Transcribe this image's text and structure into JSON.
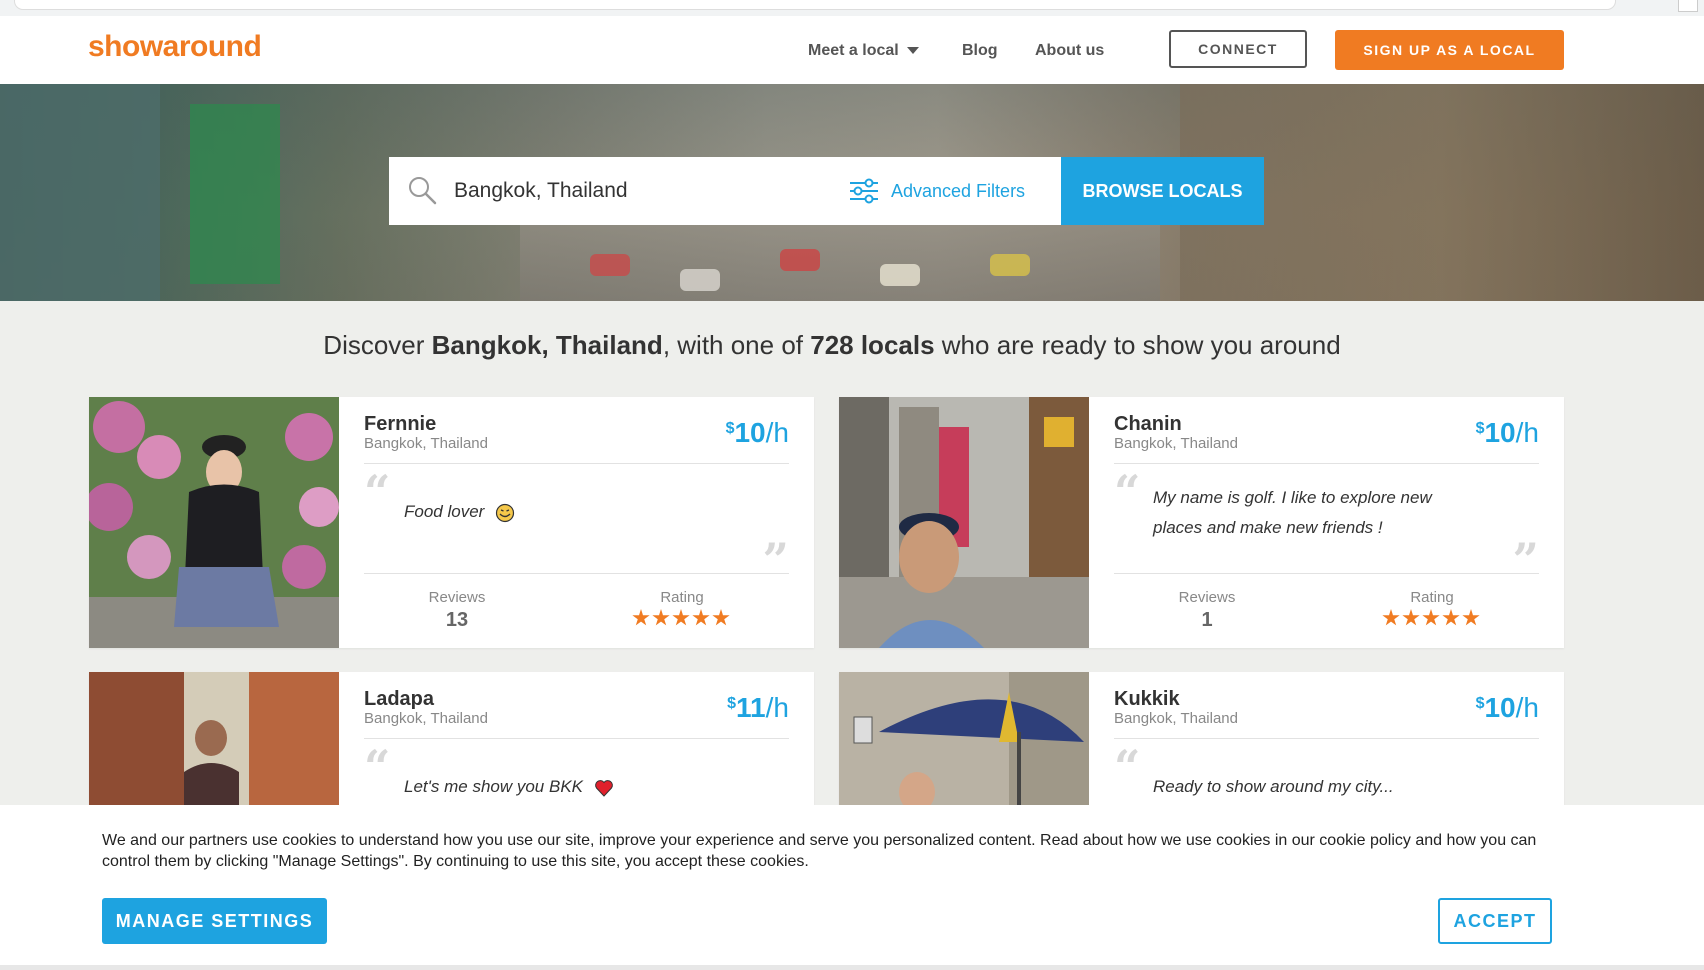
{
  "header": {
    "logo": "showaround",
    "nav": {
      "meet_local": "Meet a local",
      "blog": "Blog",
      "about": "About us"
    },
    "connect_label": "CONNECT",
    "signup_label": "SIGN UP AS A LOCAL"
  },
  "search": {
    "value": "Bangkok, Thailand",
    "filters_label": "Advanced Filters",
    "browse_label": "BROWSE LOCALS"
  },
  "discover": {
    "prefix": "Discover ",
    "city": "Bangkok, Thailand",
    "middle": ", with one of ",
    "count": "728 locals",
    "suffix": " who are ready to show you around"
  },
  "cards": [
    {
      "name": "Fernnie",
      "location": "Bangkok, Thailand",
      "price_currency": "$",
      "price_amount": "10",
      "price_unit": "/h",
      "quote": "Food lover",
      "quote_emoji": "smiling-emoji-icon",
      "reviews_label": "Reviews",
      "reviews": "13",
      "rating_label": "Rating",
      "rating": 5
    },
    {
      "name": "Chanin",
      "location": "Bangkok, Thailand",
      "price_currency": "$",
      "price_amount": "10",
      "price_unit": "/h",
      "quote": "My name is golf. I like to explore new places and make new friends !",
      "reviews_label": "Reviews",
      "reviews": "1",
      "rating_label": "Rating",
      "rating": 5
    },
    {
      "name": "Ladapa",
      "location": "Bangkok, Thailand",
      "price_currency": "$",
      "price_amount": "11",
      "price_unit": "/h",
      "quote": "Let's me show you BKK",
      "quote_emoji": "heart-icon"
    },
    {
      "name": "Kukkik",
      "location": "Bangkok, Thailand",
      "price_currency": "$",
      "price_amount": "10",
      "price_unit": "/h",
      "quote": "Ready to show around my city..."
    }
  ],
  "cookie": {
    "text": "We and our partners use cookies to understand how you use our site, improve your experience and serve you personalized content. Read about how we use cookies in our cookie policy and how you can control them by clicking \"Manage Settings\". By continuing to use this site, you accept these cookies.",
    "manage_label": "MANAGE SETTINGS",
    "accept_label": "ACCEPT"
  },
  "colors": {
    "brand_orange": "#f07b22",
    "accent_blue": "#1ea3e0"
  }
}
